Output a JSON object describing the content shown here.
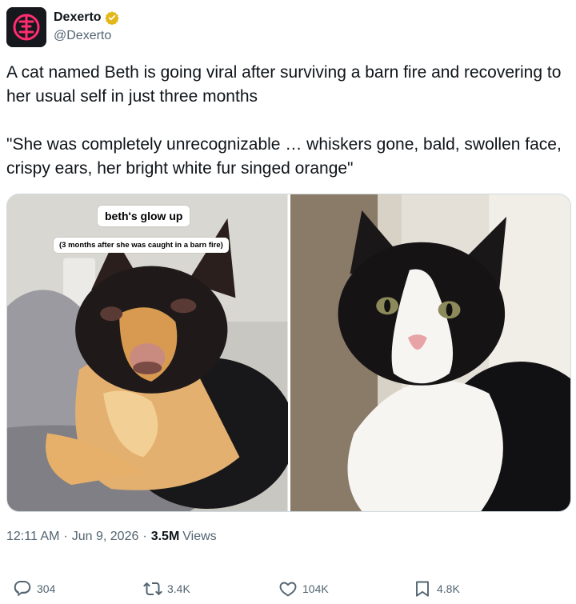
{
  "author": {
    "display_name": "Dexerto",
    "handle": "@Dexerto",
    "verified_icon": "verified-badge-icon",
    "brand_color": "#ff2d6f",
    "badge_color": "#e2b719"
  },
  "tweet": {
    "paragraph_1": "A cat named Beth is going viral after surviving a barn fire and recovering to her usual self in just three months",
    "paragraph_2": "\"She was completely unrecognizable … whiskers gone, bald, swollen face, crispy ears, her bright white fur singed orange\""
  },
  "media": {
    "overlay_title": "beth's glow up",
    "overlay_subtitle": "(3 months after she was caught in a barn fire)"
  },
  "meta": {
    "time": "12:11 AM",
    "date": "Jun 9, 2026",
    "separator": "·",
    "views_count": "3.5M",
    "views_label": "Views"
  },
  "actions": {
    "reply_count": "304",
    "retweet_count": "3.4K",
    "like_count": "104K",
    "bookmark_count": "4.8K"
  }
}
